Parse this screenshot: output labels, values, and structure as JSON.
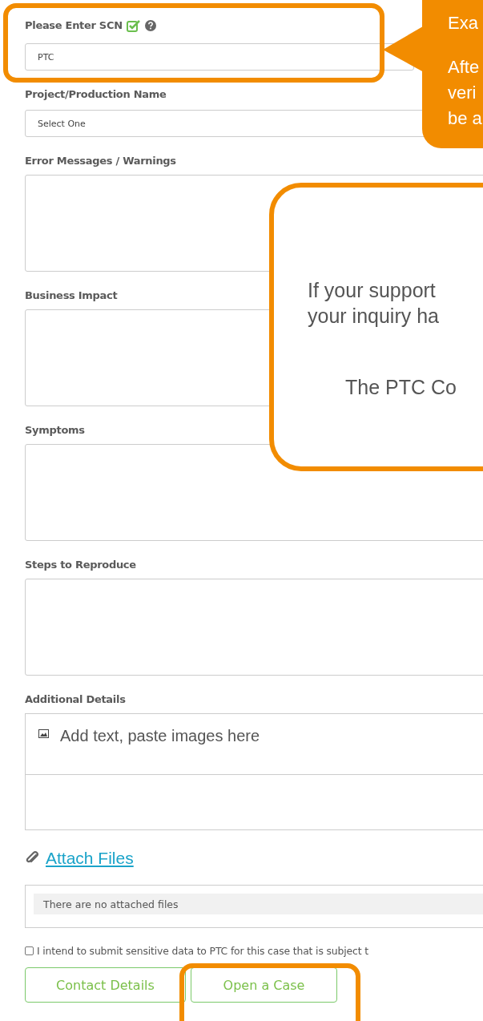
{
  "form": {
    "fields": [
      {
        "kind": "text",
        "label": "Please Enter SCN",
        "verified": true,
        "value": "PTC"
      },
      {
        "kind": "select",
        "label": "Project/Production Name",
        "value": "Select One"
      },
      {
        "kind": "textarea",
        "label": "Error Messages / Warnings"
      },
      {
        "kind": "textarea",
        "label": "Business Impact"
      },
      {
        "kind": "textarea",
        "label": "Symptoms"
      },
      {
        "kind": "textarea",
        "label": "Steps to Reproduce"
      },
      {
        "kind": "richtext",
        "label": "Additional Details",
        "placeholder": "Add text, paste images here"
      }
    ],
    "attach": {
      "link": "Attach Files",
      "empty_message": "There are no attached files"
    },
    "consent": {
      "label": "I intend to submit sensitive data to PTC for this case that is subject t",
      "checked": false
    },
    "buttons": [
      "Contact Details",
      "Open a Case"
    ]
  },
  "callout": {
    "paragraphs": [
      [
        "Exa"
      ],
      [
        "Afte",
        "veri",
        "be a"
      ]
    ]
  },
  "popup": {
    "lines": [
      "If your support",
      "your inquiry ha"
    ],
    "signature": "The PTC Co"
  }
}
